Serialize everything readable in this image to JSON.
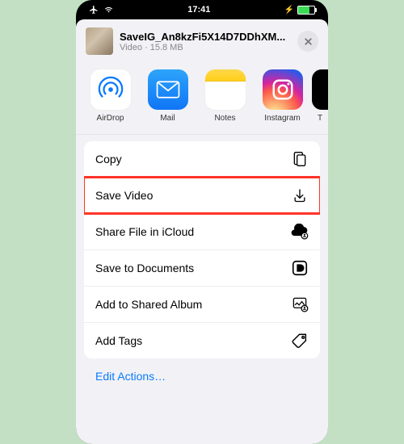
{
  "status": {
    "time": "17:41"
  },
  "file": {
    "name": "SaveIG_An8kzFi5X14D7DDhXM...",
    "subtitle": "Video · 15.8 MB"
  },
  "apps": [
    {
      "label": "AirDrop"
    },
    {
      "label": "Mail"
    },
    {
      "label": "Notes"
    },
    {
      "label": "Instagram"
    },
    {
      "label": "T"
    }
  ],
  "actions": {
    "copy": "Copy",
    "save_video": "Save Video",
    "share_icloud": "Share File in iCloud",
    "save_documents": "Save to Documents",
    "add_shared_album": "Add to Shared Album",
    "add_tags": "Add Tags"
  },
  "edit_label": "Edit Actions…"
}
